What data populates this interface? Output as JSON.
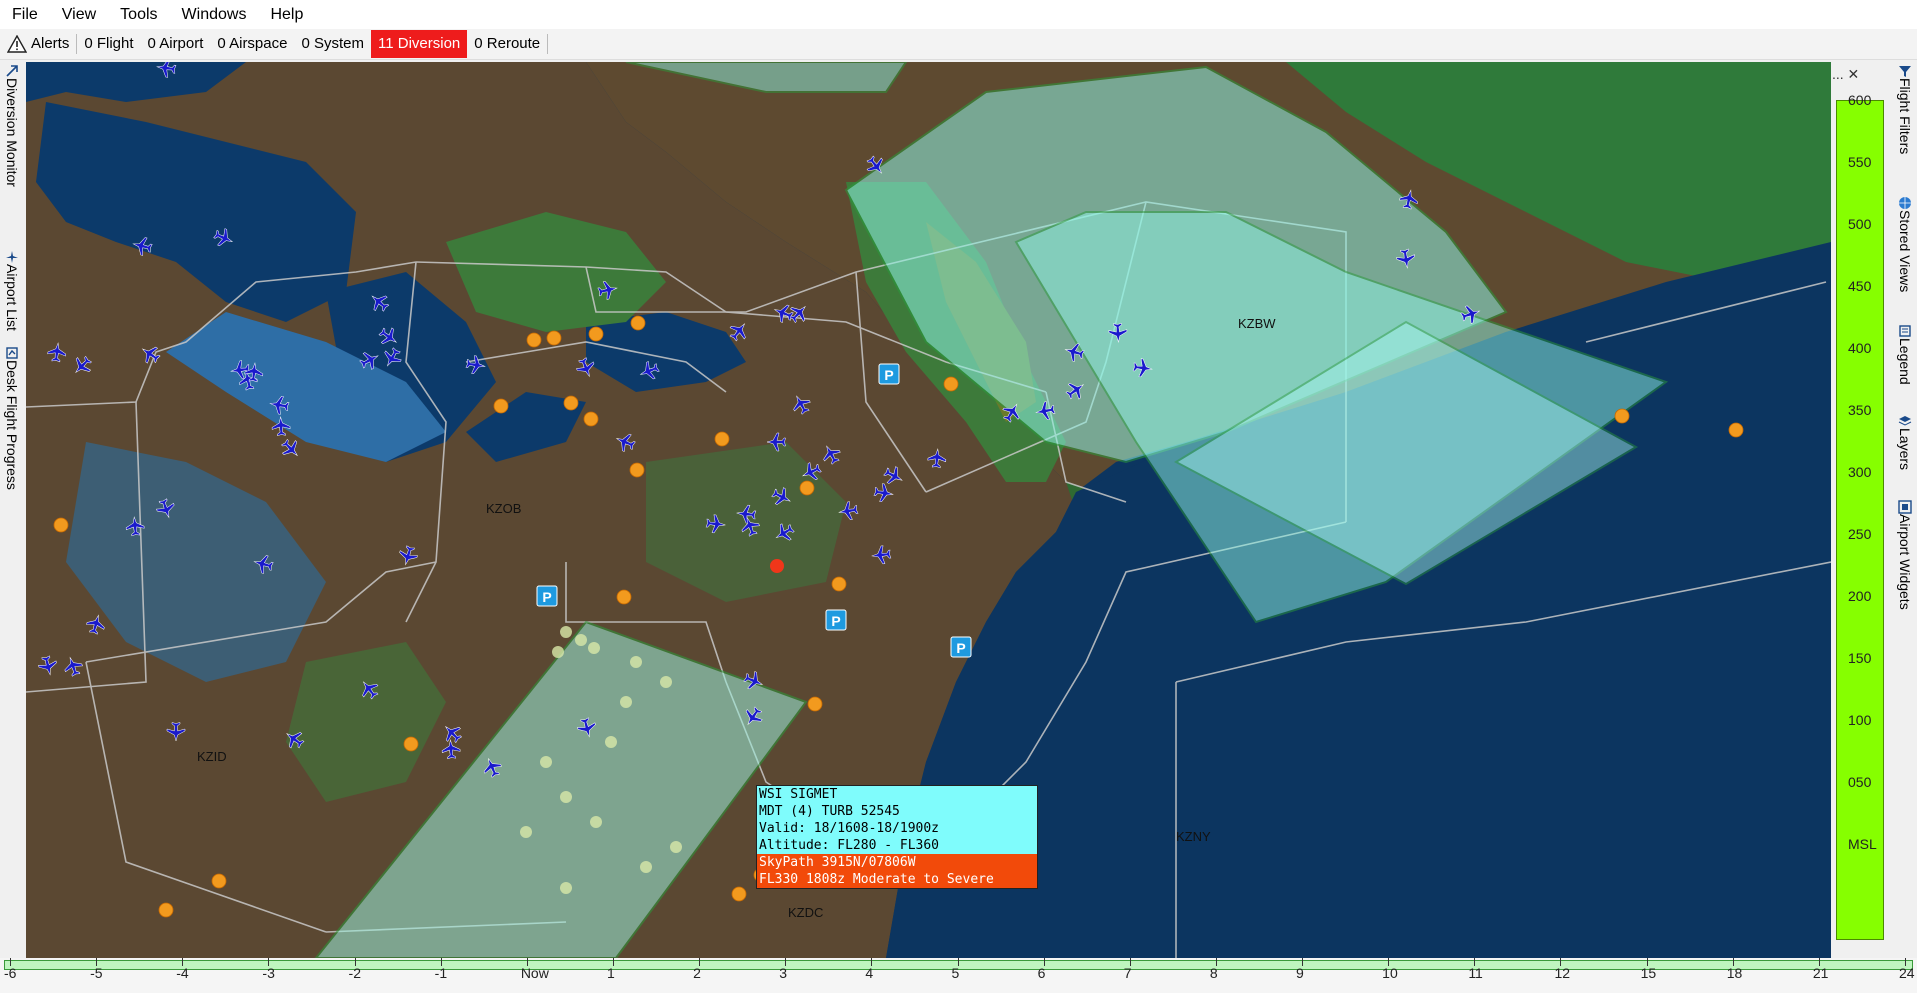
{
  "menu": [
    "File",
    "View",
    "Tools",
    "Windows",
    "Help"
  ],
  "alerts": {
    "label": "Alerts",
    "items": [
      {
        "text": "0 Flight",
        "highlight": false
      },
      {
        "text": "0 Airport",
        "highlight": false
      },
      {
        "text": "0 Airspace",
        "highlight": false
      },
      {
        "text": "0 System",
        "highlight": false
      },
      {
        "text": "11 Diversion",
        "highlight": true
      },
      {
        "text": "0 Reroute",
        "highlight": false
      }
    ]
  },
  "left_tabs": [
    "Diversion Monitor",
    "Airport List",
    "Desk Flight Progress"
  ],
  "right_tabs": [
    "Flight Filters",
    "Stored Views",
    "Legend",
    "Layers",
    "Airport Widgets"
  ],
  "map": {
    "centers": [
      "KZBW",
      "KZOB",
      "KZID",
      "KZDC",
      "KZNY"
    ],
    "parking_marker": "P"
  },
  "tooltip": {
    "line1": "WSI SIGMET",
    "line2": "MDT (4) TURB 52545",
    "line3": "Valid: 18/1608-18/1900z",
    "line4": "Altitude: FL280 - FL360",
    "line5": "SkyPath 3915N/07806W",
    "line6": "FL330 1808z Moderate to Severe"
  },
  "altitude": {
    "ticks": [
      "600",
      "550",
      "500",
      "450",
      "400",
      "350",
      "300",
      "250",
      "200",
      "150",
      "100",
      "050",
      "MSL"
    ],
    "controls": "... ✕",
    "color": "#86ff00"
  },
  "timeline": {
    "labels": [
      "-6",
      "-5",
      "-4",
      "-3",
      "-2",
      "-1",
      "Now",
      "1",
      "2",
      "3",
      "4",
      "5",
      "6",
      "7",
      "8",
      "9",
      "10",
      "11",
      "12",
      "15",
      "18",
      "21",
      "24"
    ]
  },
  "colors": {
    "diversion": "#ee1c1c",
    "sigmet": "#7ffcfc",
    "skypath": "#f24a0a",
    "aircraft": "#1a1acc"
  }
}
